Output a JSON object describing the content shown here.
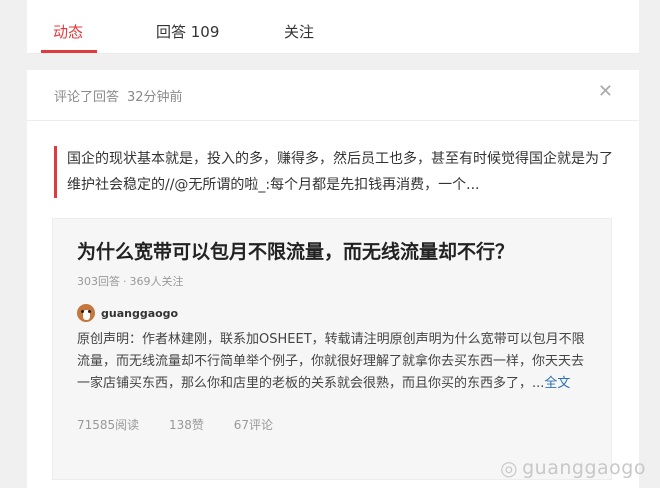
{
  "tabs": [
    {
      "label": "动态",
      "active": true
    },
    {
      "label": "回答 109",
      "active": false
    },
    {
      "label": "关注",
      "active": false
    }
  ],
  "activity": {
    "action": "评论了回答",
    "time": "32分钟前",
    "close_icon": "close-icon",
    "comment": "国企的现状基本就是，投入的多，赚得多，然后员工也多，甚至有时候觉得国企就是为了维护社会稳定的//@无所谓的啦_:每个月都是先扣钱再消费，一个..."
  },
  "question": {
    "title": "为什么宽带可以包月不限流量，而无线流量却不行？",
    "answers": "303回答",
    "separator": "·",
    "followers": "369人关注",
    "author": "guanggaogo",
    "excerpt": "原创声明：作者林建刚，联系加OSHEET，转载请注明原创声明为什么宽带可以包月不限流量，而无线流量却不行简单举个例子，你就很好理解了就拿你去买东西一样，你天天去一家店铺买东西，那么你和店里的老板的关系就会很熟，而且你买的东西多了，...",
    "more_link": "全文",
    "reads": "71585阅读",
    "likes": "138赞",
    "comments": "67评论"
  },
  "watermark": {
    "text": "guanggaogo",
    "icon": "weibo-icon"
  },
  "colors": {
    "accent": "#e0393e",
    "link": "#2e6fb5"
  }
}
